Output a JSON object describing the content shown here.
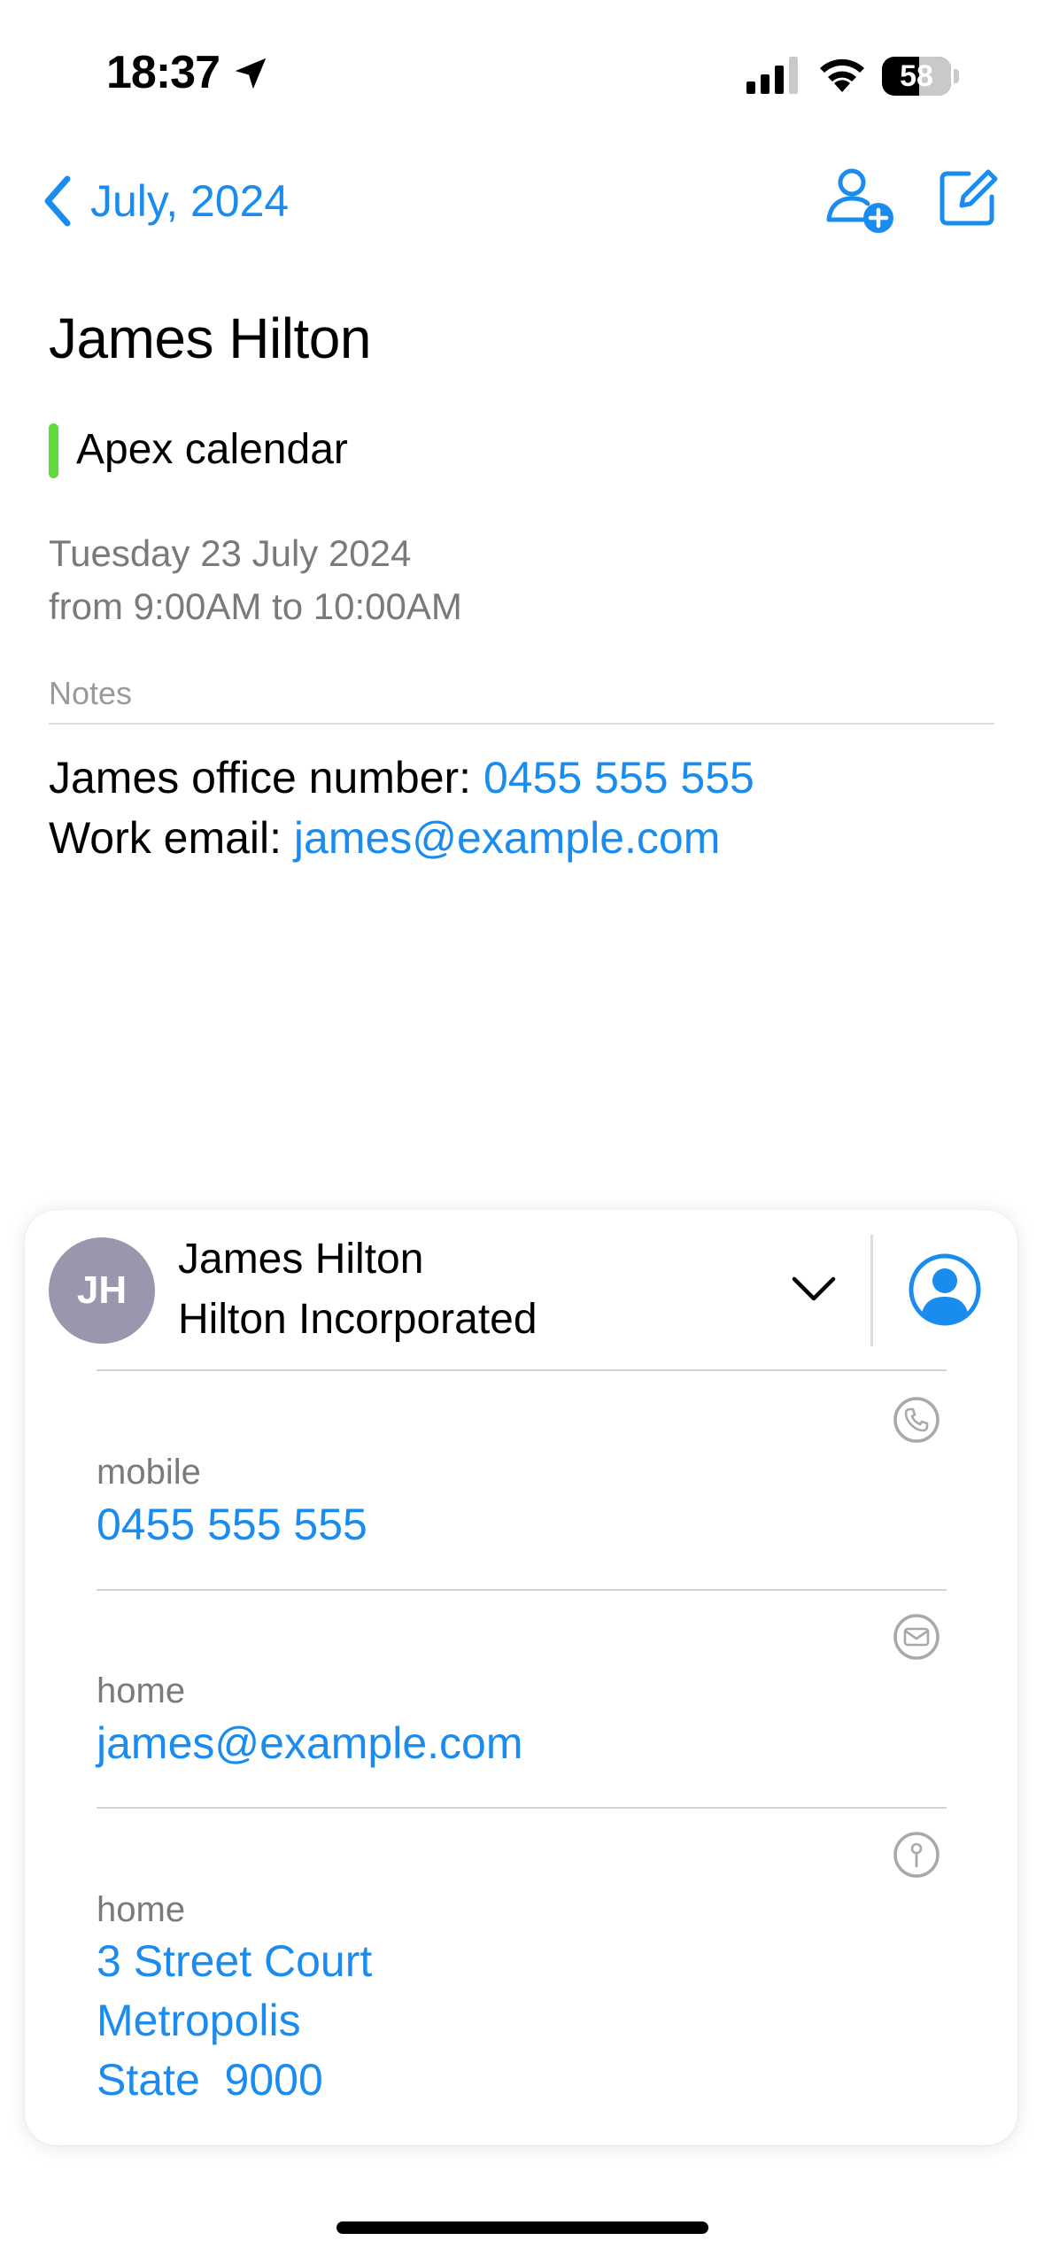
{
  "status_bar": {
    "time": "18:37",
    "battery": "58"
  },
  "nav": {
    "back_label": "July, 2024"
  },
  "event": {
    "title": "James Hilton",
    "calendar": "Apex calendar",
    "calendar_color": "#5fdb3b",
    "date_line": "Tuesday 23 July 2024",
    "time_line": "from 9:00AM to 10:00AM"
  },
  "notes": {
    "heading": "Notes",
    "office_label": "James office number: ",
    "office_number": "0455 555 555",
    "email_label": "Work email: ",
    "email": "james@example.com"
  },
  "contact": {
    "initials": "JH",
    "name": "James Hilton",
    "company": "Hilton Incorporated",
    "phone": {
      "label": "mobile",
      "value": "0455 555 555"
    },
    "email": {
      "label": "home",
      "value": "james@example.com"
    },
    "address": {
      "label": "home",
      "lines": [
        "3 Street Court",
        "Metropolis",
        "State  9000"
      ]
    }
  },
  "colors": {
    "accent": "#1a8cf0",
    "secondary_text": "#7a7a7e",
    "avatar_bg": "#9897ad"
  },
  "icons": {
    "back": "chevron-left-icon",
    "add_person": "person-add-icon",
    "edit": "compose-icon",
    "expand": "chevron-down-icon",
    "contact": "person-circle-icon",
    "phone": "phone-icon",
    "mail": "mail-icon",
    "map": "map-pin-icon"
  }
}
